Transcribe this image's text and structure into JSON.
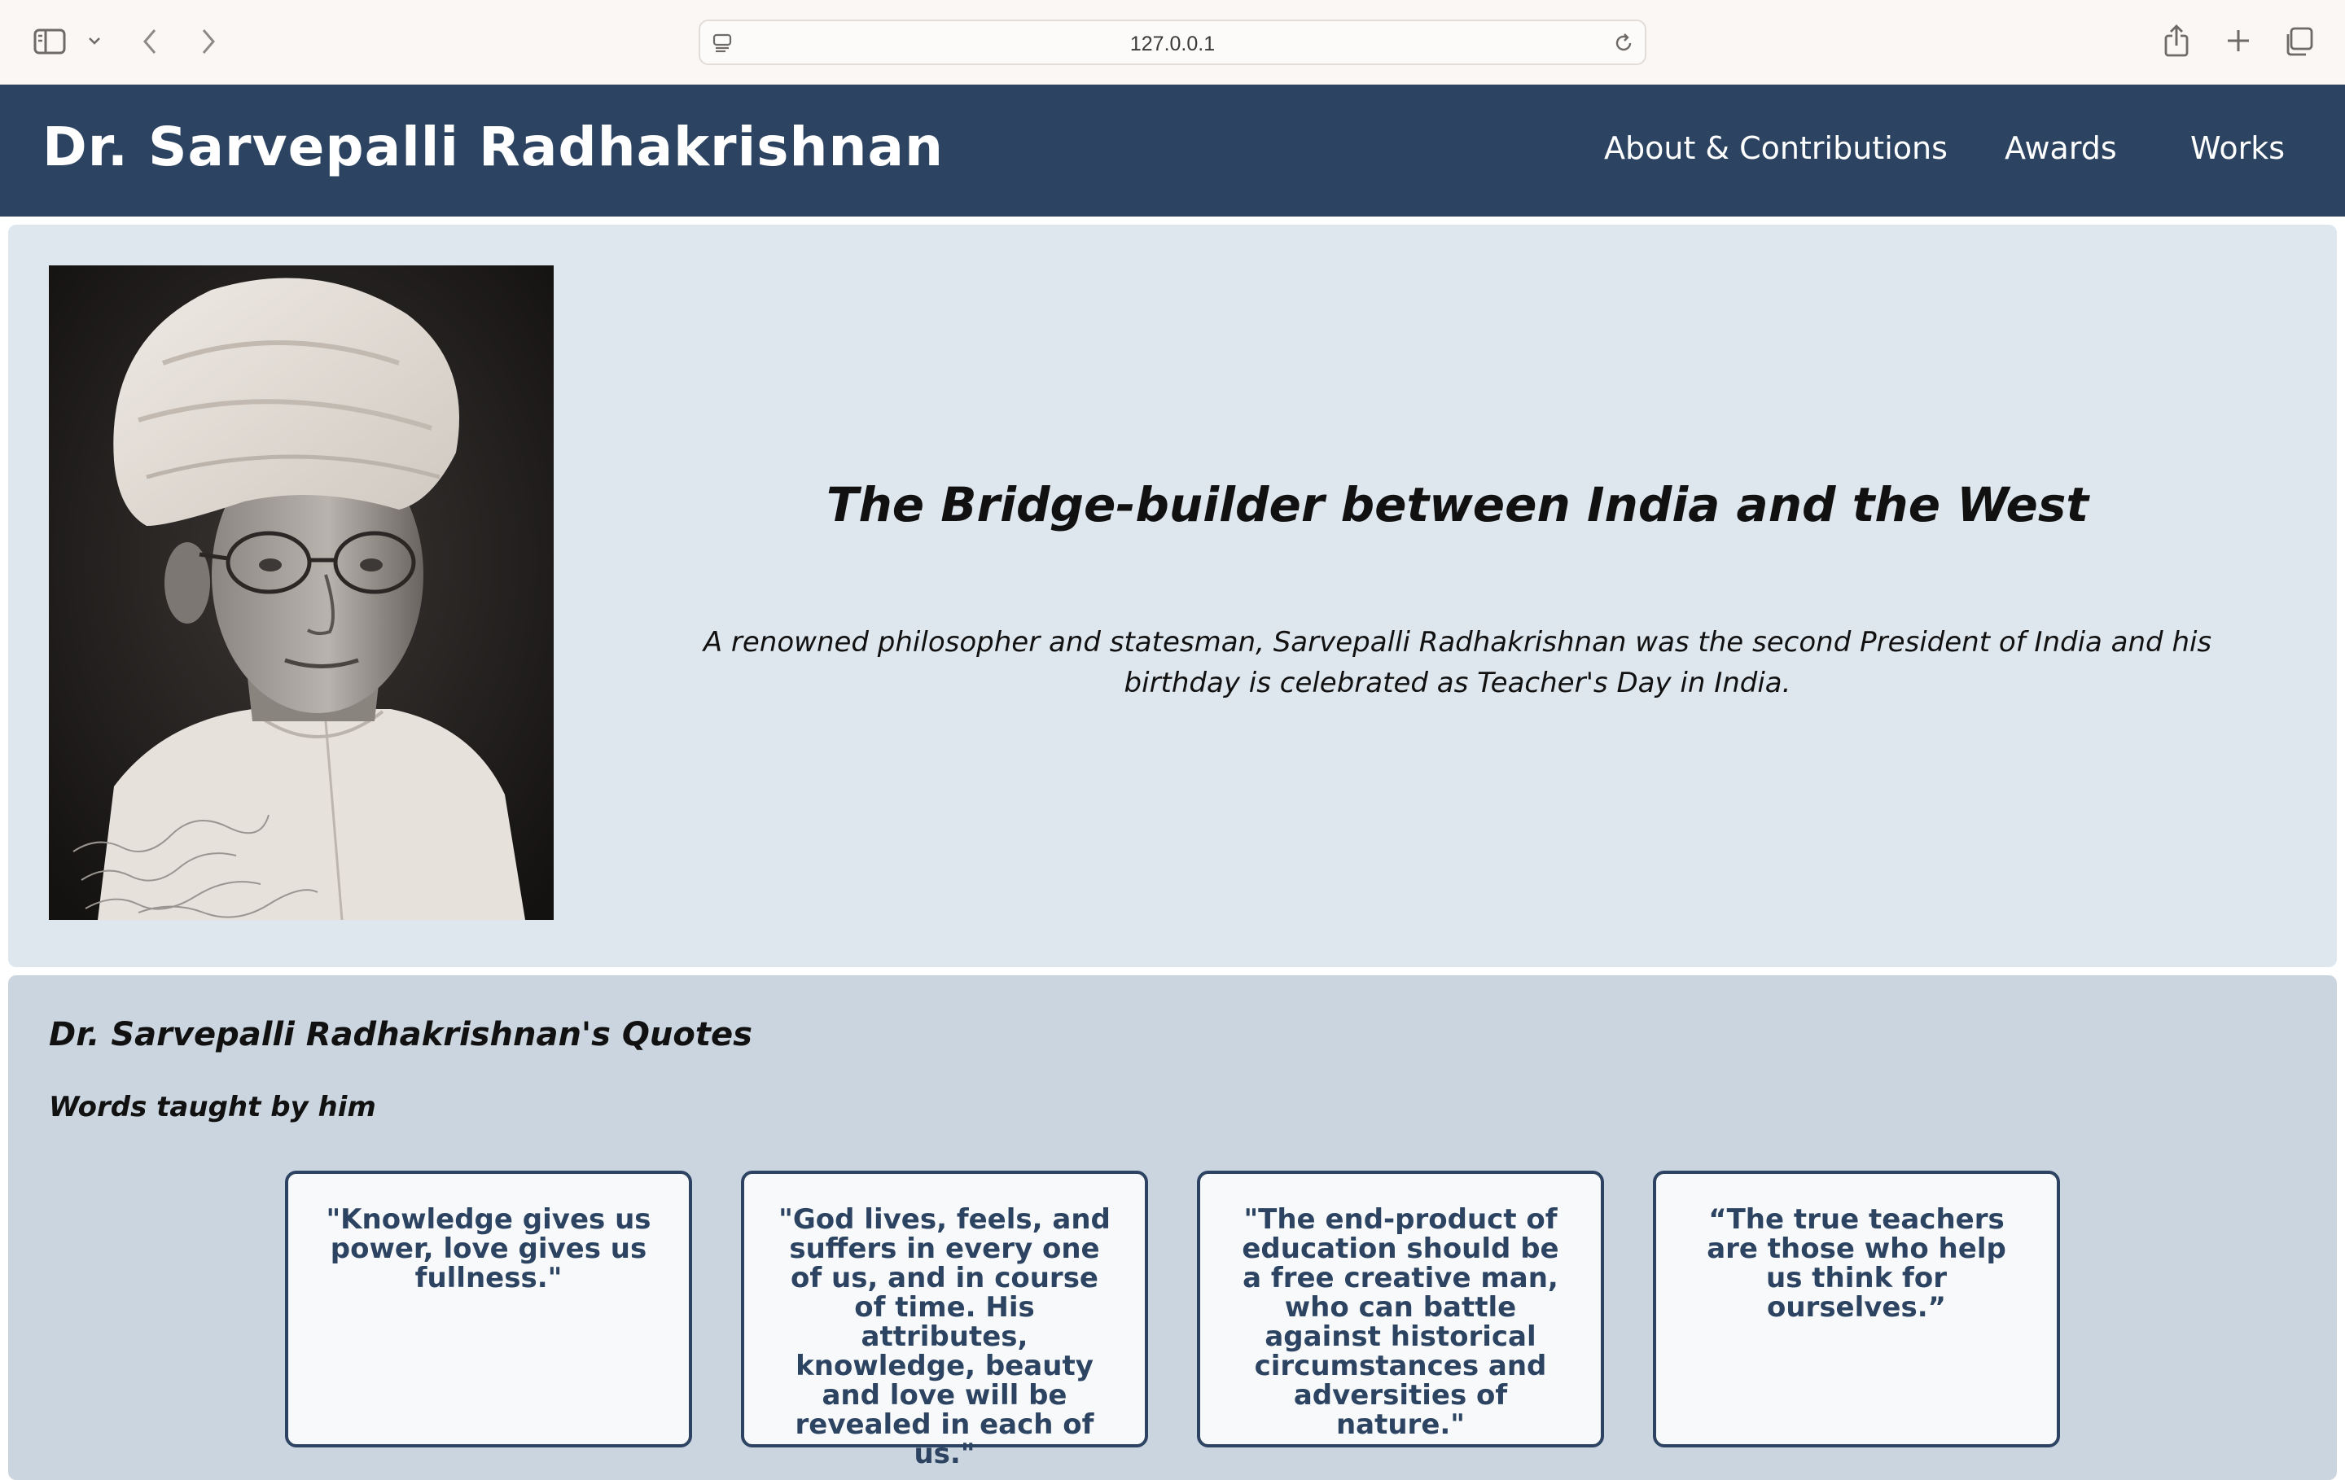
{
  "browser": {
    "url": "127.0.0.1"
  },
  "site": {
    "title": "Dr. Sarvepalli Radhakrishnan",
    "nav": [
      "About & Contributions",
      "Awards",
      "Works"
    ]
  },
  "hero": {
    "heading": "The Bridge-builder between India and the West",
    "text": "A renowned philosopher and statesman, Sarvepalli Radhakrishnan was the second President of India and his birthday is celebrated as Teacher's Day in India.",
    "signature_lines": [
      "Mr John F. Kennedy",
      "Mrs J. Kennedy",
      "with the best wishes",
      "S. Radhakrishnan",
      "14/3/62"
    ]
  },
  "quotes": {
    "title": "Dr. Sarvepalli Radhakrishnan's Quotes",
    "subtitle": "Words taught by him",
    "items": [
      "\"Knowledge gives us power, love gives us fullness.\"",
      "\"God lives, feels, and suffers in every one of us, and in course of time. His attributes, knowledge, beauty and love will be revealed in each of us.\"",
      "\"The end-product of education should be a free creative man, who can battle against historical circumstances and adversities of nature.\"",
      "“The true teachers are those who help us think for ourselves.”"
    ]
  }
}
